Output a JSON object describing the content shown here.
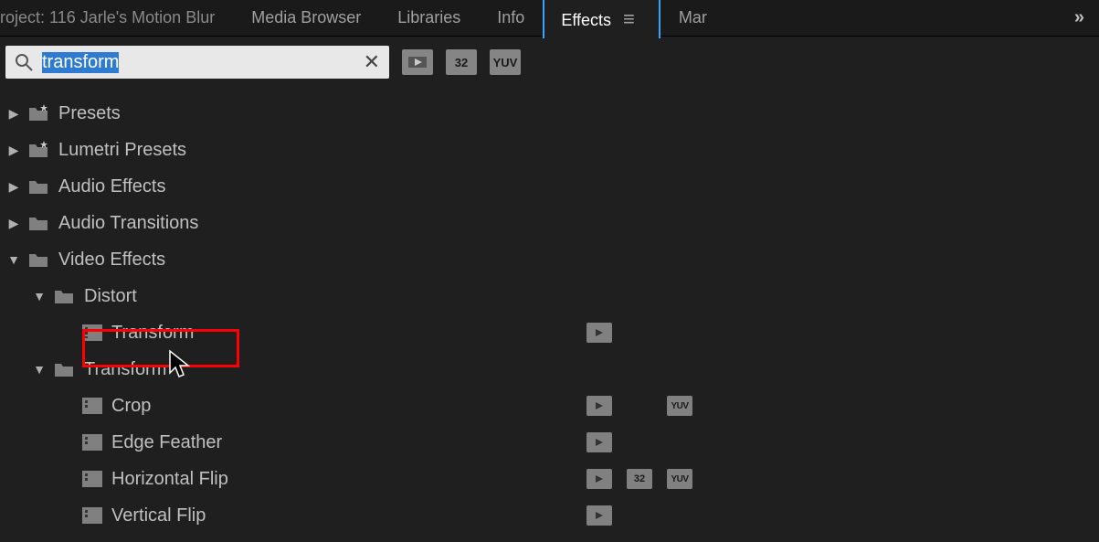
{
  "tabs": {
    "project": "roject: 116 Jarle's Motion Blur",
    "media_browser": "Media Browser",
    "libraries": "Libraries",
    "info": "Info",
    "effects": "Effects",
    "mar": "Mar"
  },
  "search": {
    "value": "transform"
  },
  "filters": {
    "b32": "32",
    "yuv": "YUV"
  },
  "tree": {
    "presets": "Presets",
    "lumetri": "Lumetri Presets",
    "audio_effects": "Audio Effects",
    "audio_transitions": "Audio Transitions",
    "video_effects": "Video Effects",
    "distort": "Distort",
    "transform_effect": "Transform",
    "transform_folder": "Transform",
    "crop": "Crop",
    "edge_feather": "Edge Feather",
    "hflip": "Horizontal Flip",
    "vflip": "Vertical Flip"
  },
  "badges": {
    "b32": "32",
    "yuv": "YUV"
  }
}
